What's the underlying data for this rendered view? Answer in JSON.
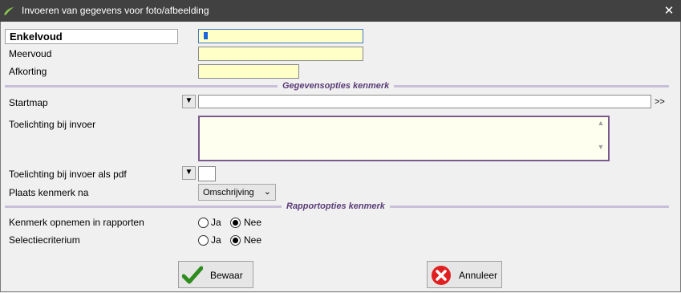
{
  "window": {
    "title": "Invoeren van gegevens voor foto/afbeelding",
    "close_glyph": "✕"
  },
  "form": {
    "enkelvoud_label": "Enkelvoud",
    "meervoud_label": "Meervoud",
    "afkorting_label": "Afkorting",
    "enkelvoud_value": "",
    "meervoud_value": "",
    "afkorting_value": ""
  },
  "gegevensopties": {
    "header": "Gegevensopties kenmerk",
    "startmap_label": "Startmap",
    "startmap_value": "",
    "startmap_more": ">>",
    "toelichting_label": "Toelichting bij invoer",
    "toelichting_value": "",
    "toelichting_pdf_label": "Toelichting bij invoer als pdf",
    "plaats_label": "Plaats kenmerk na",
    "plaats_value": "Omschrijving"
  },
  "rapportopties": {
    "header": "Rapportopties kenmerk",
    "opnemen_label": "Kenmerk opnemen in rapporten",
    "selectie_label": "Selectiecriterium",
    "ja_label": "Ja",
    "nee_label": "Nee",
    "opnemen_selected": "Nee",
    "selectie_selected": "Nee"
  },
  "buttons": {
    "save_label": "Bewaar",
    "cancel_label": "Annuleer"
  },
  "colors": {
    "titlebar": "#414141",
    "input_bg": "#ffffc8",
    "header_text": "#5a3c78",
    "save_icon": "#2e8b1e",
    "cancel_icon": "#e02020"
  }
}
